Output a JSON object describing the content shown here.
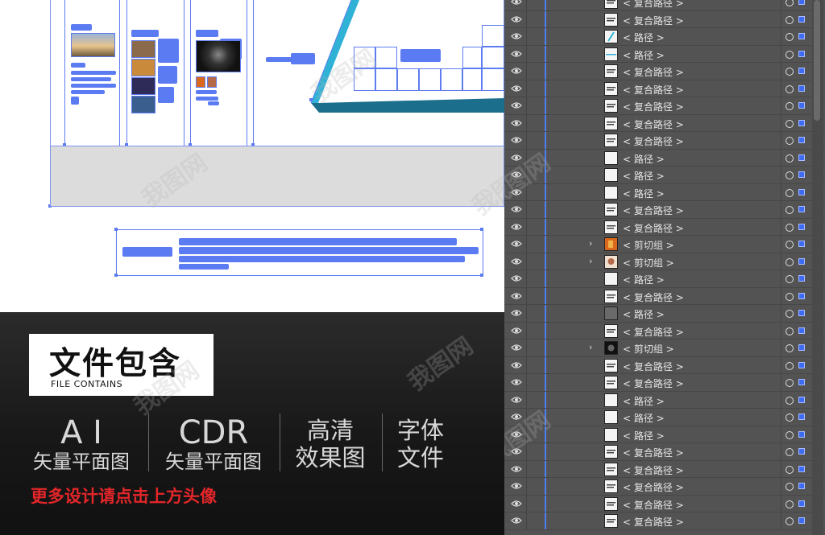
{
  "promo": {
    "contains_title": "文件包含",
    "contains_subtitle": "FILE CONTAINS",
    "formats": [
      {
        "main": "A I",
        "sub": "矢量平面图"
      },
      {
        "main": "CDR",
        "sub": "矢量平面图"
      },
      {
        "line1": "高清",
        "line2": "效果图"
      },
      {
        "line1": "字体",
        "line2": "文件"
      }
    ],
    "more_link": "更多设计请点击上方头像",
    "accent_color": "#e3262a"
  },
  "watermark": "我图网",
  "layers_panel": {
    "selection_color": "#3d6bf2",
    "rows": [
      {
        "label": "< 复合路径 >",
        "thumb": "text",
        "expandable": false
      },
      {
        "label": "< 复合路径 >",
        "thumb": "text",
        "expandable": false
      },
      {
        "label": "< 路径 >",
        "thumb": "slash",
        "expandable": false
      },
      {
        "label": "< 路径 >",
        "thumb": "line",
        "expandable": false
      },
      {
        "label": "< 复合路径 >",
        "thumb": "text",
        "expandable": false
      },
      {
        "label": "< 复合路径 >",
        "thumb": "text",
        "expandable": false
      },
      {
        "label": "< 复合路径 >",
        "thumb": "text",
        "expandable": false
      },
      {
        "label": "< 复合路径 >",
        "thumb": "text",
        "expandable": false
      },
      {
        "label": "< 复合路径 >",
        "thumb": "text",
        "expandable": false
      },
      {
        "label": "< 路径 >",
        "thumb": "blank",
        "expandable": false
      },
      {
        "label": "< 路径 >",
        "thumb": "blank",
        "expandable": false
      },
      {
        "label": "< 路径 >",
        "thumb": "blank",
        "expandable": false
      },
      {
        "label": "< 复合路径 >",
        "thumb": "text",
        "expandable": false
      },
      {
        "label": "< 复合路径 >",
        "thumb": "text",
        "expandable": false
      },
      {
        "label": "< 剪切组 >",
        "thumb": "photo-fire",
        "expandable": true
      },
      {
        "label": "< 剪切组 >",
        "thumb": "photo-portrait",
        "expandable": true
      },
      {
        "label": "< 路径 >",
        "thumb": "blank",
        "expandable": false
      },
      {
        "label": "< 复合路径 >",
        "thumb": "text",
        "expandable": false
      },
      {
        "label": "< 路径 >",
        "thumb": "grey",
        "expandable": false
      },
      {
        "label": "< 复合路径 >",
        "thumb": "text",
        "expandable": false
      },
      {
        "label": "< 剪切组 >",
        "thumb": "photo-dark",
        "expandable": true
      },
      {
        "label": "< 复合路径 >",
        "thumb": "text",
        "expandable": false
      },
      {
        "label": "< 复合路径 >",
        "thumb": "text",
        "expandable": false
      },
      {
        "label": "< 路径 >",
        "thumb": "blank",
        "expandable": false
      },
      {
        "label": "< 路径 >",
        "thumb": "blank",
        "expandable": false
      },
      {
        "label": "< 路径 >",
        "thumb": "blank",
        "expandable": false
      },
      {
        "label": "< 复合路径 >",
        "thumb": "text",
        "expandable": false
      },
      {
        "label": "< 复合路径 >",
        "thumb": "text",
        "expandable": false
      },
      {
        "label": "< 复合路径 >",
        "thumb": "text",
        "expandable": false
      },
      {
        "label": "< 复合路径 >",
        "thumb": "text",
        "expandable": false
      },
      {
        "label": "< 复合路径 >",
        "thumb": "text",
        "expandable": false
      }
    ]
  }
}
